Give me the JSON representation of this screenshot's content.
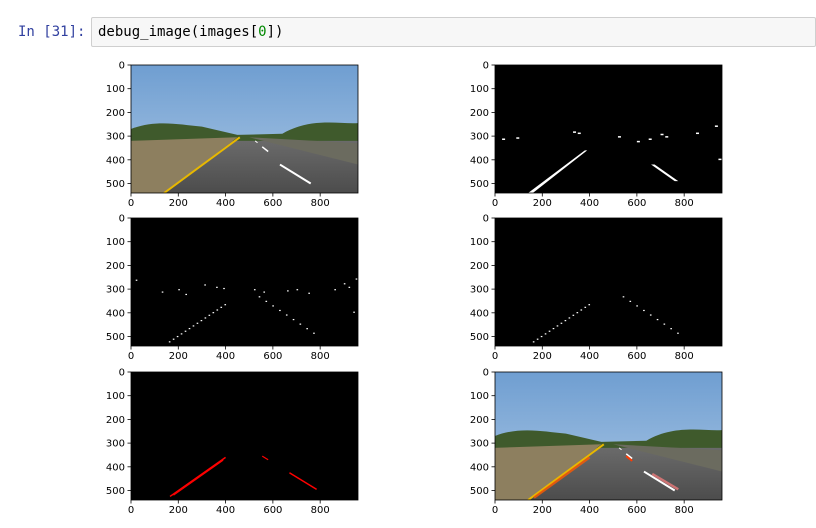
{
  "cell": {
    "prompt": "In [31]:",
    "code_fn": "debug_image(images[",
    "code_idx": "0",
    "code_end": "])"
  },
  "figure": {
    "x_ticks": [
      "0",
      "200",
      "400",
      "600",
      "800"
    ],
    "y_ticks": [
      "0",
      "100",
      "200",
      "300",
      "400",
      "500"
    ],
    "panels": [
      {
        "name": "original-road-image"
      },
      {
        "name": "threshold-mask-image"
      },
      {
        "name": "edges-image"
      },
      {
        "name": "region-masked-edges-image"
      },
      {
        "name": "hough-lines-image"
      },
      {
        "name": "lane-overlay-image"
      }
    ]
  }
}
